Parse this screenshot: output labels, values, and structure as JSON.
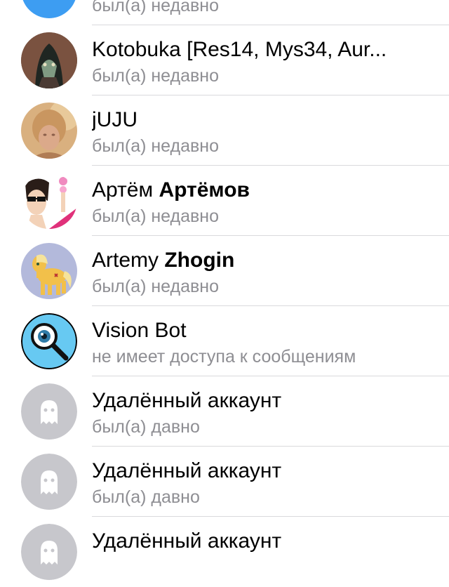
{
  "contacts": [
    {
      "first": "",
      "last": "",
      "status": "был(а) недавно",
      "avatar": "blue-circle-avatar"
    },
    {
      "first": "Kotobuka [Res14, Mys34, Aur...",
      "last": "",
      "status": "был(а) недавно",
      "avatar": "hooded-character-avatar"
    },
    {
      "first": "jUJU",
      "last": "",
      "status": "был(а) недавно",
      "avatar": "blurred-girl-photo-avatar"
    },
    {
      "first": "Артём",
      "last": "Артёмов",
      "status": "был(а) недавно",
      "avatar": "anime-character-avatar"
    },
    {
      "first": "Artemy",
      "last": "Zhogin",
      "status": "был(а) недавно",
      "avatar": "pony-avatar"
    },
    {
      "first": "Vision Bot",
      "last": "",
      "status": "не имеет доступа к сообщениям",
      "avatar": "magnifier-eye-icon"
    },
    {
      "first": "Удалённый аккаунт",
      "last": "",
      "status": "был(а) давно",
      "avatar": "ghost-icon"
    },
    {
      "first": "Удалённый аккаунт",
      "last": "",
      "status": "был(а) давно",
      "avatar": "ghost-icon"
    },
    {
      "first": "Удалённый аккаунт",
      "last": "",
      "status": "",
      "avatar": "ghost-icon"
    }
  ],
  "colors": {
    "name": "#000000",
    "status": "#8e8e93",
    "divider": "#d9d9dc",
    "ghost_avatar_bg": "#c7c7cc",
    "top_avatar_blue": "#3d9df2"
  }
}
